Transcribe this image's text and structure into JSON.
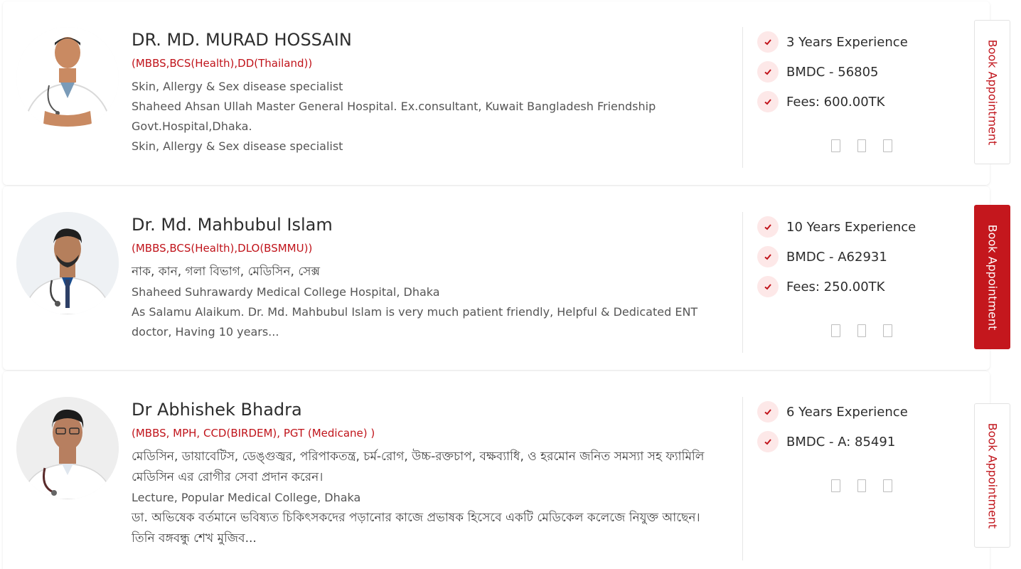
{
  "colors": {
    "accent": "#c0131a",
    "check_bg": "#fde8e8",
    "text": "#2d2d2d",
    "muted": "#555555"
  },
  "doctors": [
    {
      "name": "DR. MD. MURAD HOSSAIN",
      "degree": "(MBBS,BCS(Health),DD(Thailand))",
      "lines": [
        "Skin, Allergy & Sex disease specialist",
        "Shaheed Ahsan Ullah Master General Hospital. Ex.consultant, Kuwait Bangladesh Friendship Govt.Hospital,Dhaka.",
        "Skin, Allergy & Sex disease specialist"
      ],
      "stats": [
        "3 Years Experience",
        "BMDC - 56805",
        "Fees: 600.00TK"
      ],
      "book_label": "Book Appointment",
      "book_active": false,
      "avatar_icon": "doctor-photo"
    },
    {
      "name": "Dr. Md. Mahbubul Islam",
      "degree": "(MBBS,BCS(Health),DLO(BSMMU))",
      "lines": [
        "নাক, কান, গলা বিভাগ, মেডিসিন, সেক্স",
        "Shaheed Suhrawardy Medical College Hospital, Dhaka",
        "As Salamu Alaikum. Dr. Md. Mahbubul Islam is very much patient friendly, Helpful & Dedicated ENT doctor, Having 10 years..."
      ],
      "stats": [
        "10 Years Experience",
        "BMDC - A62931",
        "Fees: 250.00TK"
      ],
      "book_label": "Book Appointment",
      "book_active": true,
      "avatar_icon": "doctor-photo"
    },
    {
      "name": "Dr Abhishek Bhadra",
      "degree": "(MBBS, MPH, CCD(BIRDEM), PGT (Medicane) )",
      "lines": [
        "মেডিসিন, ডায়াবেটিস, ডেঙ্গুজ্বর, পরিপাকতন্ত্র, চর্ম-রোগ, উচ্চ-রক্তচাপ, বক্ষব্যাধি, ও হরমোন জনিত সমস্যা সহ ফ্যামিলি মেডিসিন এর রোগীর সেবা প্রদান করেন।",
        "Lecture, Popular Medical College, Dhaka",
        "ডা. অভিষেক বর্তমানে ভবিষ্যত চিকিৎসকদের পড়ানোর কাজে প্রভাষক হিসেবে একটি মেডিকেল কলেজে নিযুক্ত আছেন। তিনি বঙ্গবন্ধু শেখ মুজিব..."
      ],
      "stats": [
        "6 Years Experience",
        "BMDC - A: 85491"
      ],
      "book_label": "Book Appointment",
      "book_active": false,
      "avatar_icon": "doctor-photo"
    }
  ]
}
